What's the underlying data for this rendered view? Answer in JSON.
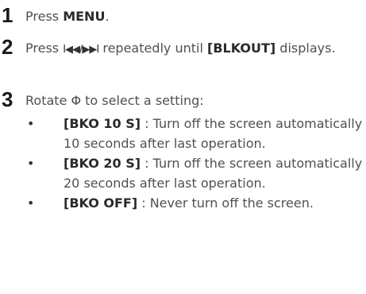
{
  "steps": [
    {
      "number": "1",
      "text_before": "Press ",
      "bold": "MENU",
      "text_after": "."
    },
    {
      "number": "2",
      "text_before": "Press ",
      "control": "I◀◀/▶▶I",
      "text_mid": " repeatedly until ",
      "bold": "[BLKOUT]",
      "text_after": " displays."
    },
    {
      "number": "3",
      "text_before": "Rotate ",
      "control": "Φ",
      "text_after": " to select a setting:"
    }
  ],
  "options": [
    {
      "bullet": "•",
      "label": "[BKO 10 S]",
      "description": " : Turn off the screen automatically 10 seconds after last operation."
    },
    {
      "bullet": "•",
      "label": "[BKO 20 S]",
      "description": " : Turn off the screen automatically 20 seconds after last operation."
    },
    {
      "bullet": "•",
      "label": "[BKO OFF]",
      "description": " : Never turn off the screen."
    }
  ]
}
